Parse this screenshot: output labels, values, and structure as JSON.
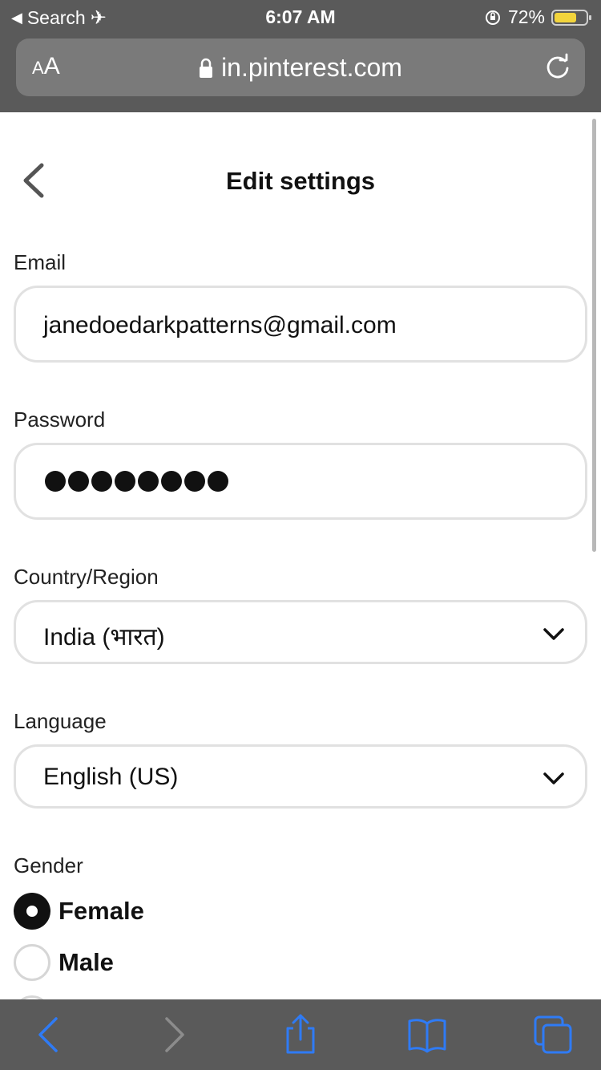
{
  "status_bar": {
    "back_app": "Search",
    "time": "6:07 AM",
    "battery_pct": "72%",
    "battery_level": 0.72
  },
  "browser": {
    "text_size_label_small": "A",
    "text_size_label_large": "A",
    "host": "in.pinterest.com"
  },
  "page": {
    "title": "Edit settings",
    "email": {
      "label": "Email",
      "value": "janedoedarkpatterns@gmail.com"
    },
    "password": {
      "label": "Password",
      "mask_count": 8
    },
    "country": {
      "label": "Country/Region",
      "value": "India (भारत)"
    },
    "language": {
      "label": "Language",
      "value": "English (US)"
    },
    "gender": {
      "label": "Gender",
      "options": [
        {
          "label": "Female",
          "selected": true
        },
        {
          "label": "Male",
          "selected": false
        }
      ]
    }
  },
  "colors": {
    "chrome_bg": "#5a5a5a",
    "toolbar_icon": "#2f7bf5",
    "field_border": "#e1e1e1"
  }
}
